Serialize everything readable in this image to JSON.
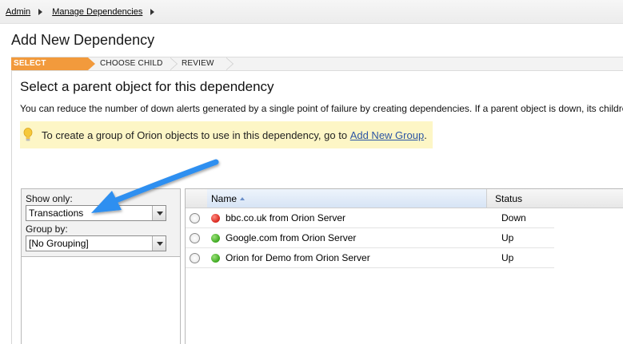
{
  "breadcrumb": [
    {
      "label": "Admin"
    },
    {
      "label": "Manage Dependencies"
    }
  ],
  "page_title": "Add New Dependency",
  "wizard": {
    "steps": [
      "SELECT PARENT",
      "CHOOSE CHILD",
      "REVIEW"
    ],
    "active_step": "SELECT PARENT",
    "active_color": "#f29a3c"
  },
  "section_title": "Select a parent object for this dependency",
  "description": "You can reduce the number of down alerts generated by a single point of failure by creating dependencies. If a parent object is down, its childre",
  "hint": {
    "icon": "lightbulb-icon",
    "text_before": "To create a group of Orion objects to use in this dependency, go to",
    "link": "Add New Group",
    "text_after": ".",
    "background": "#fdf6c6"
  },
  "filters": {
    "show_only_label": "Show only:",
    "show_only_value": "Transactions",
    "group_by_label": "Group by:",
    "group_by_value": "[No Grouping]"
  },
  "table": {
    "columns": {
      "name": "Name",
      "status": "Status"
    },
    "rows": [
      {
        "name": "bbc.co.uk from Orion Server",
        "status": "Down",
        "status_color": "#d8261c"
      },
      {
        "name": "Google.com from Orion Server",
        "status": "Up",
        "status_color": "#3da81f"
      },
      {
        "name": "Orion for Demo from Orion Server",
        "status": "Up",
        "status_color": "#3da81f"
      }
    ]
  },
  "annotation": {
    "arrow_color": "#2d8ff0"
  }
}
